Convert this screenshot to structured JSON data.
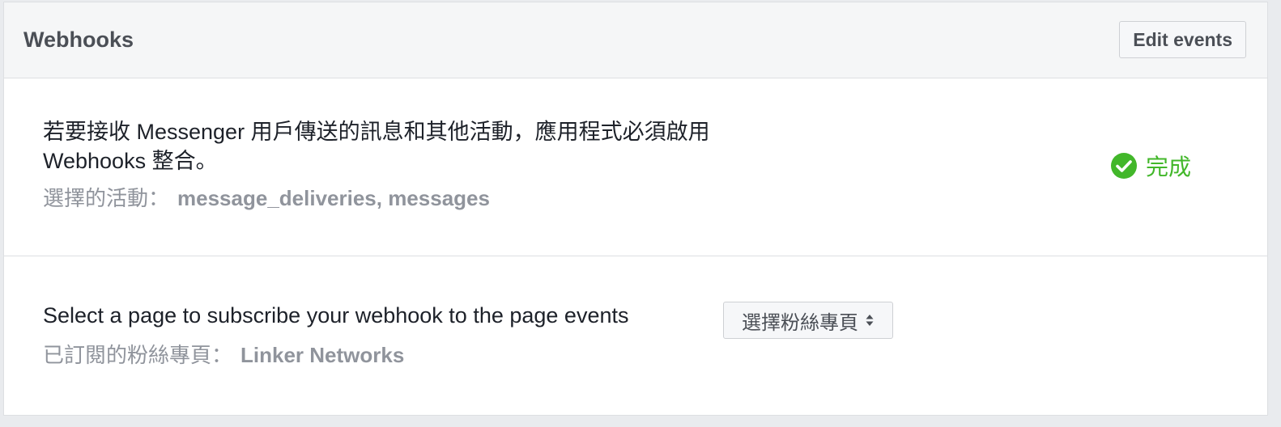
{
  "header": {
    "title": "Webhooks",
    "edit_label": "Edit events"
  },
  "webhooks": {
    "description": "若要接收 Messenger 用戶傳送的訊息和其他活動，應用程式必須啟用 Webhooks 整合。",
    "selected_label": "選擇的活動：",
    "selected_value": "message_deliveries, messages",
    "status_label": "完成",
    "status_color": "#42b72a"
  },
  "subscribe": {
    "text": "Select a page to subscribe your webhook to the page events",
    "select_value": "選擇粉絲專頁",
    "subscribed_label": "已訂閱的粉絲專頁：",
    "subscribed_value": "Linker Networks"
  },
  "icons": {
    "status": "check-circle-icon",
    "select": "sort-arrows-icon"
  }
}
